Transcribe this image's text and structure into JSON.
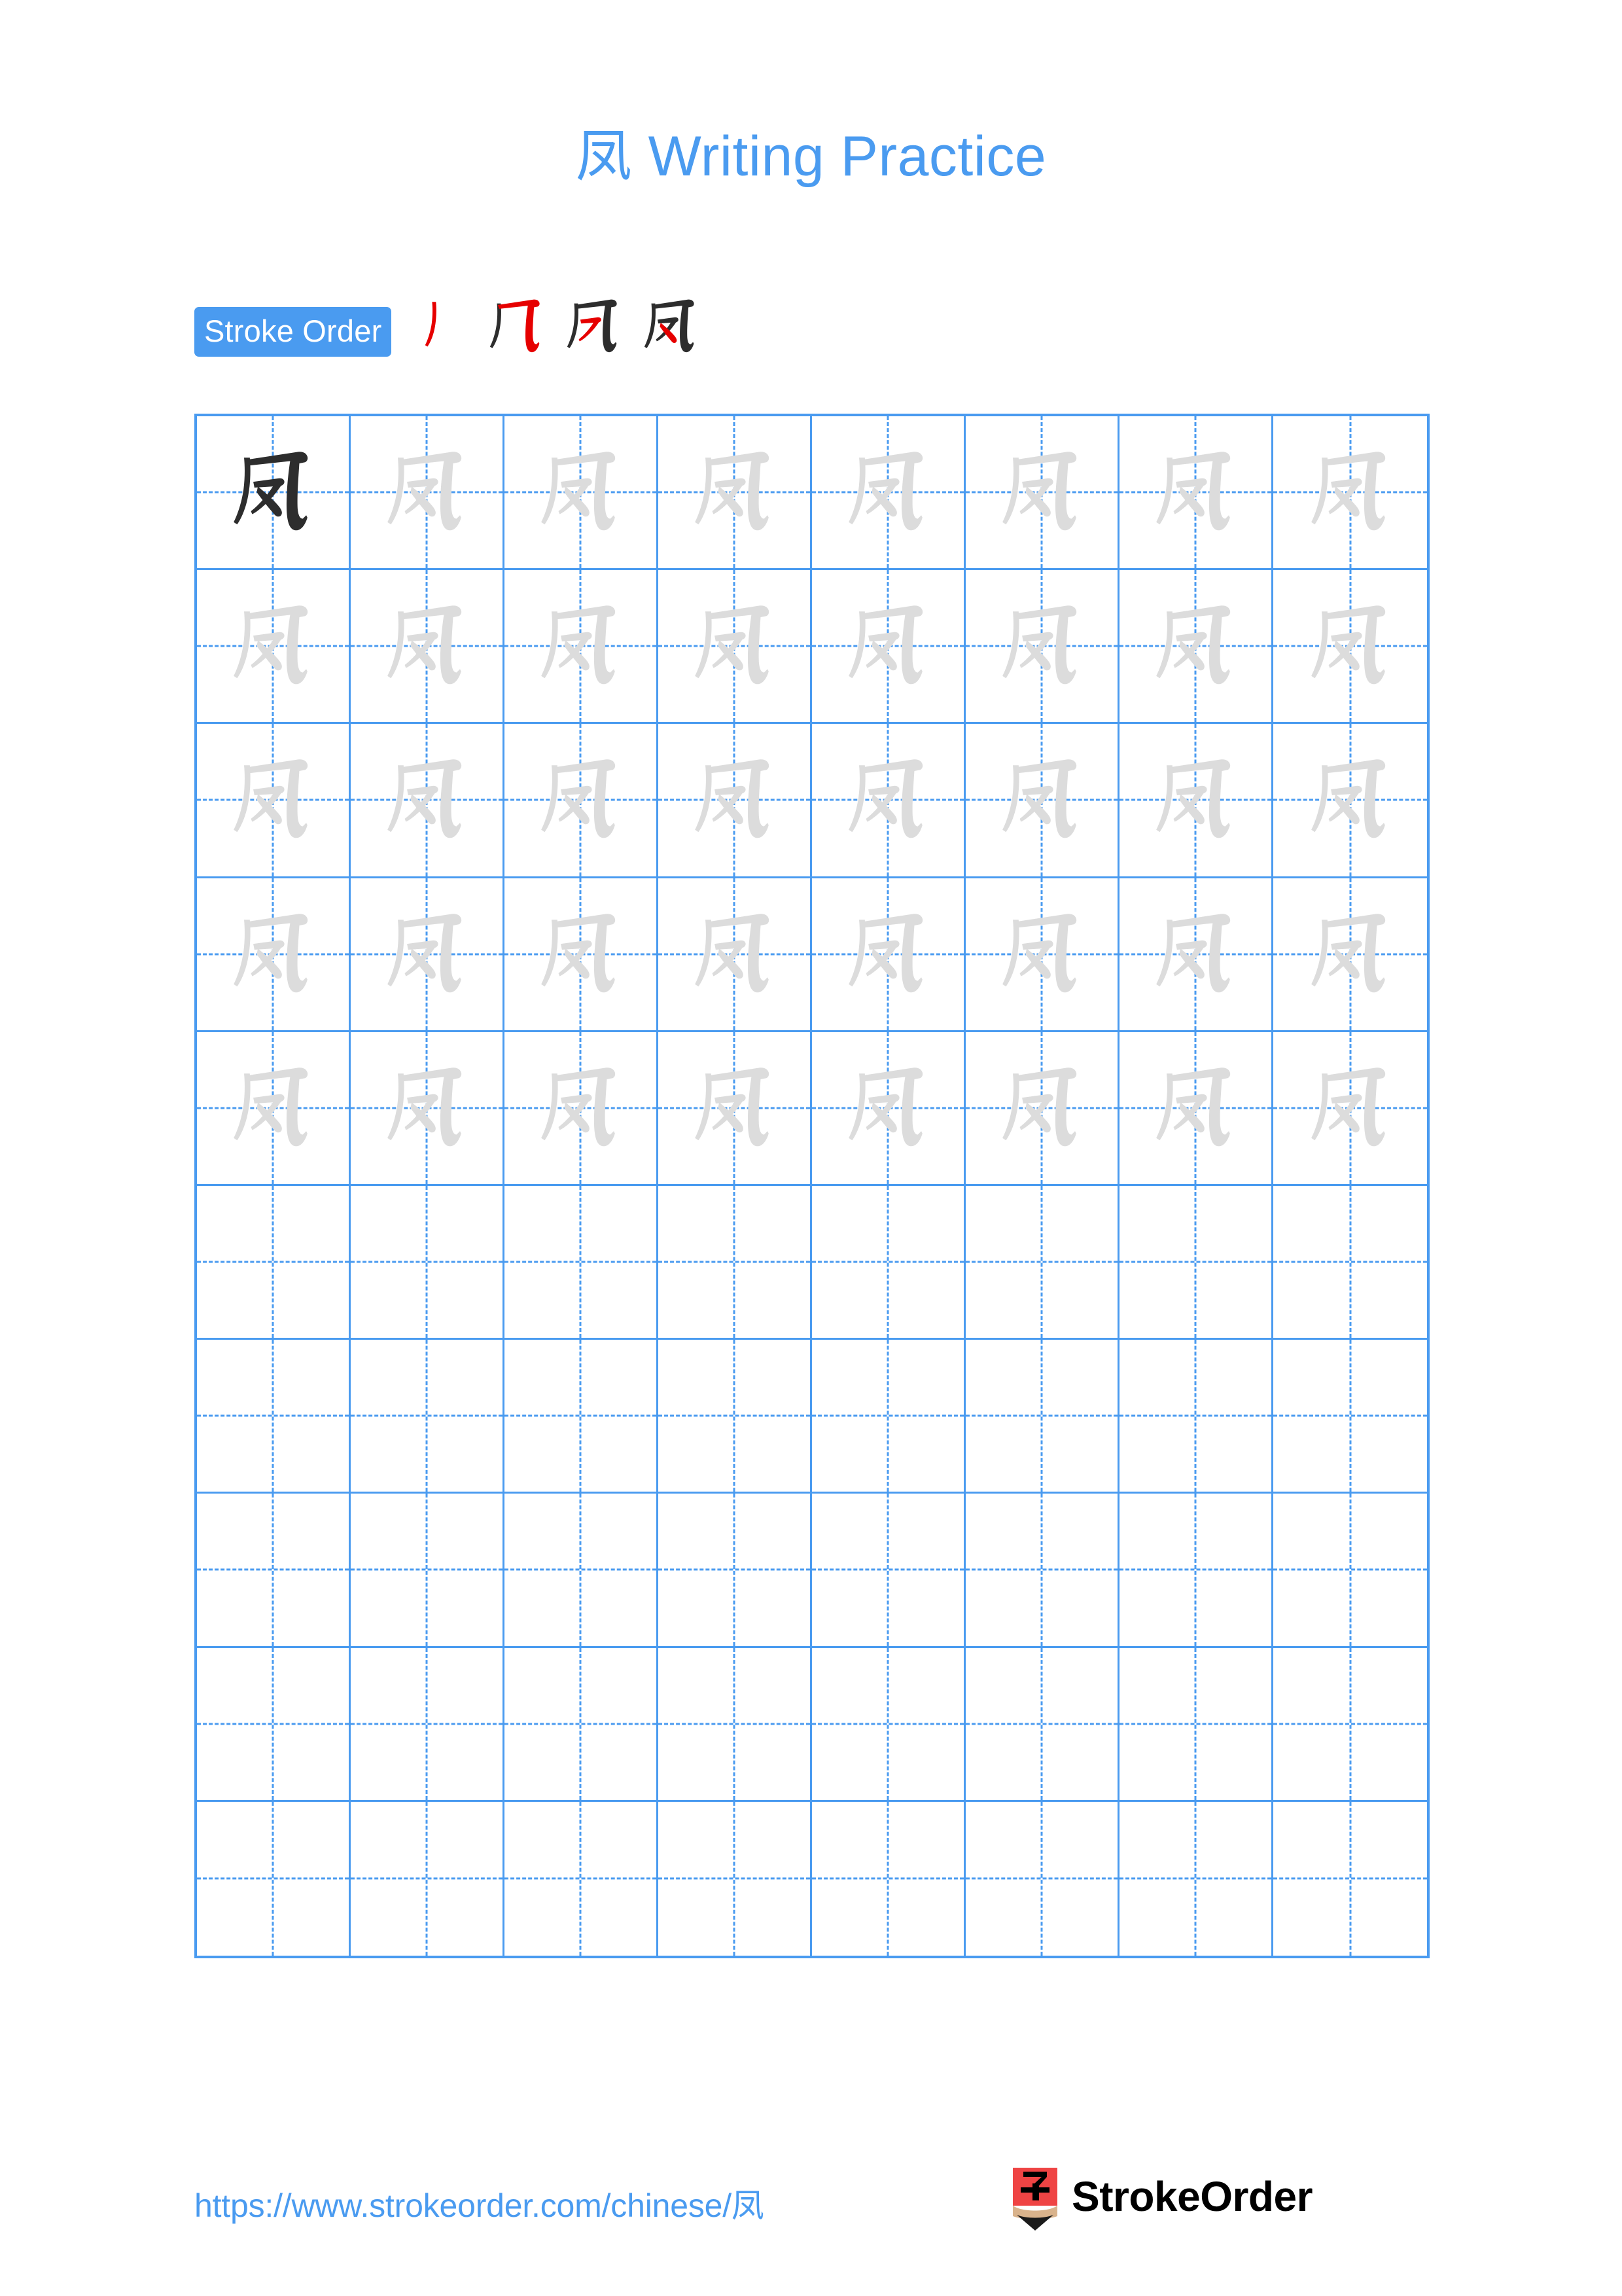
{
  "document": {
    "character": "凤",
    "title": "凤 Writing Practice"
  },
  "stroke_order": {
    "badge_label": "Stroke Order",
    "accent_color": "#4a9bf0",
    "new_stroke_color": "#e60000",
    "done_stroke_color": "#2d2d2d",
    "total_strokes": 4,
    "steps": [
      {
        "step": 1,
        "stroke_name": "pie",
        "description": "丿 left-falling stroke"
      },
      {
        "step": 2,
        "stroke_name": "heng-zhe-wan-gou",
        "description": "横折弯钩 horizontal-bend-hook"
      },
      {
        "step": 3,
        "stroke_name": "pie",
        "description": "丿 inner left-falling stroke"
      },
      {
        "step": 4,
        "stroke_name": "na",
        "description": "㇏ right-falling stroke"
      }
    ]
  },
  "practice_grid": {
    "columns": 8,
    "rows": 10,
    "grid_line_color": "#4a9bf0",
    "guide_line_style": "dashed",
    "model_char_color": "#2d2d2d",
    "trace_char_color": "#dcdcdc",
    "filled_rows": 5,
    "empty_rows": 5,
    "model_cell_index": 0,
    "cell_characters": [
      [
        "凤",
        "凤",
        "凤",
        "凤",
        "凤",
        "凤",
        "凤",
        "凤"
      ],
      [
        "凤",
        "凤",
        "凤",
        "凤",
        "凤",
        "凤",
        "凤",
        "凤"
      ],
      [
        "凤",
        "凤",
        "凤",
        "凤",
        "凤",
        "凤",
        "凤",
        "凤"
      ],
      [
        "凤",
        "凤",
        "凤",
        "凤",
        "凤",
        "凤",
        "凤",
        "凤"
      ],
      [
        "凤",
        "凤",
        "凤",
        "凤",
        "凤",
        "凤",
        "凤",
        "凤"
      ],
      [
        "",
        "",
        "",
        "",
        "",
        "",
        "",
        ""
      ],
      [
        "",
        "",
        "",
        "",
        "",
        "",
        "",
        ""
      ],
      [
        "",
        "",
        "",
        "",
        "",
        "",
        "",
        ""
      ],
      [
        "",
        "",
        "",
        "",
        "",
        "",
        "",
        ""
      ],
      [
        "",
        "",
        "",
        "",
        "",
        "",
        "",
        ""
      ]
    ]
  },
  "footer": {
    "url": "https://www.strokeorder.com/chinese/凤",
    "brand_name": "StrokeOrder",
    "logo_character": "字",
    "logo_body_color": "#ef4444",
    "logo_wood_color": "#d9b38c",
    "logo_tip_color": "#1a1a1a"
  }
}
